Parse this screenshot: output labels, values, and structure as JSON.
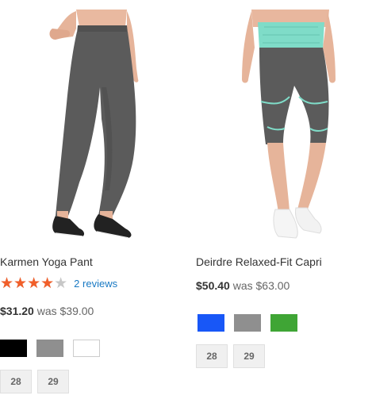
{
  "products": [
    {
      "name": "Karmen Yoga Pant",
      "rating_fraction": 0.8,
      "stars_glyphs": "★★★★★",
      "reviews_label": "2 reviews",
      "price": "$31.20",
      "was_label": "was",
      "old_price": "$39.00",
      "colors": [
        {
          "name": "black",
          "hex": "#000000"
        },
        {
          "name": "gray",
          "hex": "#8f8f8f"
        },
        {
          "name": "white",
          "hex": "#ffffff"
        }
      ],
      "sizes": [
        "28",
        "29"
      ]
    },
    {
      "name": "Deirdre Relaxed-Fit Capri",
      "price": "$50.40",
      "was_label": "was",
      "old_price": "$63.00",
      "colors": [
        {
          "name": "blue",
          "hex": "#1857f7"
        },
        {
          "name": "gray",
          "hex": "#8f8f8f"
        },
        {
          "name": "green",
          "hex": "#3fa535"
        }
      ],
      "sizes": [
        "28",
        "29"
      ]
    }
  ],
  "theme": {
    "star_color": "#f15f2a",
    "link_color": "#1979c3",
    "pant_color": "#5b5b5b",
    "waistband_color": "#7fdcc8"
  }
}
